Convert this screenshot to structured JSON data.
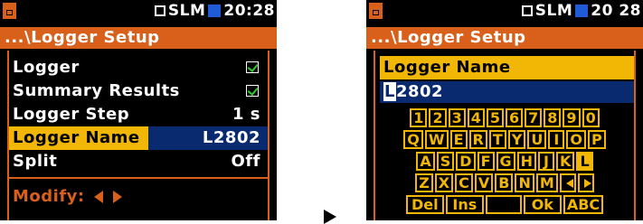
{
  "left_screen": {
    "status": {
      "mode": "SLM",
      "time": "20:28"
    },
    "path": "...\\Logger Setup",
    "rows": [
      {
        "label": "Logger",
        "checked": true
      },
      {
        "label": "Summary Results",
        "checked": true
      },
      {
        "label": "Logger Step",
        "value": "1 s"
      },
      {
        "label": "Logger Name",
        "value": "L2802",
        "selected": true
      },
      {
        "label": "Split",
        "value": "Off"
      }
    ],
    "hint": "Modify:"
  },
  "right_screen": {
    "status": {
      "mode": "SLM",
      "time": "20 28"
    },
    "path": "...\\Logger Setup",
    "editor_title": "Logger Name",
    "editor_value_cursor": "L",
    "editor_value_rest": "2802",
    "keyboard": [
      [
        "1",
        "2",
        "3",
        "4",
        "5",
        "6",
        "7",
        "8",
        "9",
        "0"
      ],
      [
        "Q",
        "W",
        "E",
        "R",
        "T",
        "Y",
        "U",
        "I",
        "O",
        "P"
      ],
      [
        "A",
        "S",
        "D",
        "F",
        "G",
        "H",
        "J",
        "K",
        "L"
      ],
      [
        "Z",
        "X",
        "C",
        "V",
        "B",
        "N",
        "M"
      ],
      [
        "Del",
        "Ins",
        "Ok",
        "ABC"
      ]
    ],
    "selected_key": "L"
  },
  "colors": {
    "accent": "#d8601a",
    "highlight": "#f2b705",
    "field": "#0a2a70"
  }
}
